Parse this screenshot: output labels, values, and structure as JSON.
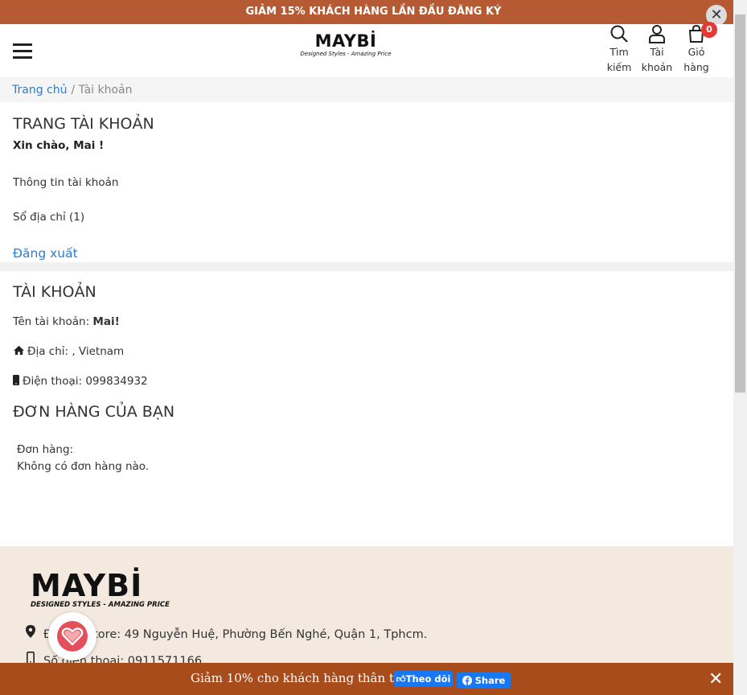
{
  "promo_top": {
    "text": "GIẢM 15% KHÁCH HÀNG LẦN ĐẦU ĐĂNG KÝ",
    "close": "✕"
  },
  "header": {
    "logo": "MAYBİ",
    "logo_tagline": "Designed Styles - Amazing Price",
    "search_label_1": "Tìm",
    "search_label_2": "kiếm",
    "account_label_1": "Tài",
    "account_label_2": "khoản",
    "cart_label_1": "Giỏ",
    "cart_label_2": "hàng",
    "cart_count": "0"
  },
  "breadcrumb": {
    "home": "Trang chủ",
    "current": "/ Tài khoản"
  },
  "account_page": {
    "title": "TRANG TÀI KHOẢN",
    "greeting": "Xin chào, Mai !",
    "account_info_link": "Thông tin tài khoản",
    "address_book_link": "Sổ địa chỉ (1)",
    "logout": "Đăng xuất"
  },
  "account_details": {
    "title": "TÀI KHOẢN",
    "username_label": "Tên tài khoản: ",
    "username_value": "Mai!",
    "address": "Địa chỉ: , Vietnam",
    "phone": "Điện thoại: 099834932"
  },
  "orders": {
    "title": "ĐƠN HÀNG CỦA BẠN",
    "label": "Đơn hàng:",
    "empty": "Không có đơn hàng nào."
  },
  "footer": {
    "logo": "MAYBİ",
    "logo_tagline": "DESIGNED STYLES - AMAZING PRICE",
    "store_address": "Địa chỉ store: 49 Nguyễn Huệ, Phường Bến Nghé, Quận 1, Tphcm.",
    "phone": "Số điện thoại: 0911571166"
  },
  "bottom_bar": {
    "text": "Giảm 10% cho khách hàng thân thiết",
    "follow": "Theo dõi",
    "share": "Share",
    "close": "✕"
  },
  "colors": {
    "accent_link": "#2a7ed0",
    "promo_bg": "#b55a33",
    "bottom_bar_bg": "#a94c1c",
    "footer_bg": "#f3e9df",
    "badge": "#e53935"
  }
}
